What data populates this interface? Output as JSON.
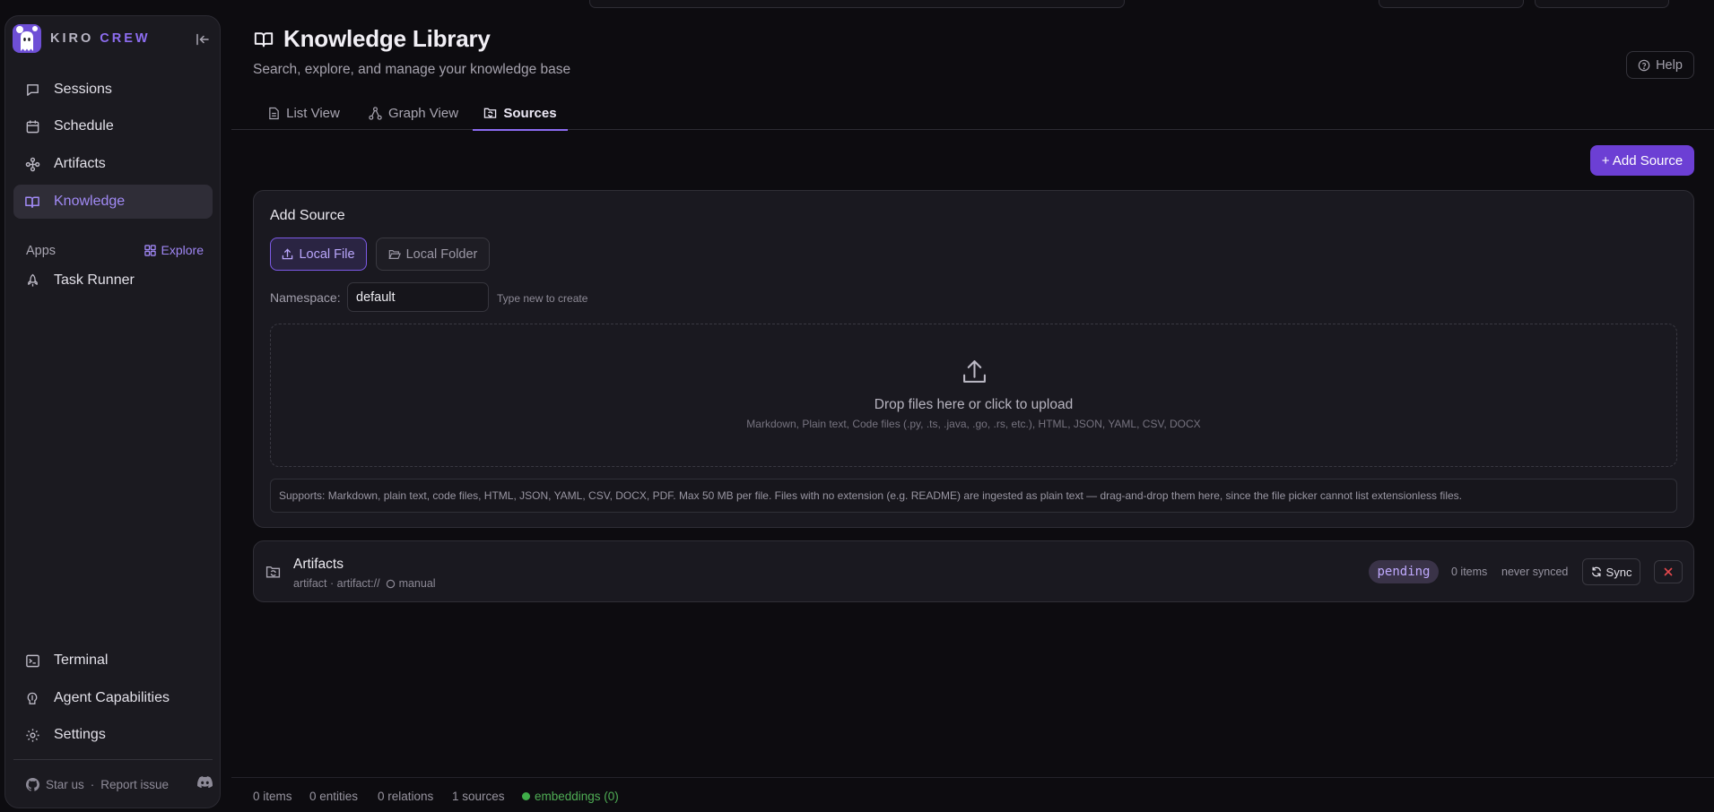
{
  "brand": {
    "word1": "KIRO",
    "word2": "CREW"
  },
  "colors": {
    "accent": "#6c3fd4",
    "accent_text": "#a18af5",
    "background": "#0d0c10",
    "panel": "#1a1920",
    "success": "#3fae49",
    "danger": "#e5484d"
  },
  "sidebar": {
    "nav": [
      {
        "label": "Sessions",
        "icon": "chat-bubble-icon"
      },
      {
        "label": "Schedule",
        "icon": "calendar-icon"
      },
      {
        "label": "Artifacts",
        "icon": "artifacts-icon"
      },
      {
        "label": "Knowledge",
        "icon": "book-icon",
        "active": true
      }
    ],
    "apps_label": "Apps",
    "explore_label": "Explore",
    "apps": [
      {
        "label": "Task Runner",
        "icon": "rocket-icon"
      }
    ],
    "bottom_nav": [
      {
        "label": "Terminal",
        "icon": "terminal-icon"
      },
      {
        "label": "Agent Capabilities",
        "icon": "brain-icon"
      },
      {
        "label": "Settings",
        "icon": "gear-icon"
      }
    ],
    "footer": {
      "star": "Star us",
      "separator": "·",
      "report": "Report issue"
    }
  },
  "header": {
    "title": "Knowledge Library",
    "subtitle": "Search, explore, and manage your knowledge base",
    "help_label": "Help"
  },
  "tabs": [
    {
      "label": "List View",
      "icon": "document-icon"
    },
    {
      "label": "Graph View",
      "icon": "graph-icon"
    },
    {
      "label": "Sources",
      "icon": "folder-sync-icon",
      "active": true
    }
  ],
  "add_source_button": "+ Add Source",
  "add_source_panel": {
    "title": "Add Source",
    "local_file_label": "Local File",
    "local_folder_label": "Local Folder",
    "namespace_label": "Namespace:",
    "namespace_value": "default",
    "namespace_hint": "Type new to create",
    "dropzone_title": "Drop files here or click to upload",
    "dropzone_formats": "Markdown, Plain text, Code files (.py, .ts, .java, .go, .rs, etc.), HTML, JSON, YAML, CSV, DOCX",
    "supports_text": "Supports: Markdown, plain text, code files, HTML, JSON, YAML, CSV, DOCX, PDF. Max 50 MB per file. Files with no extension (e.g. README) are ingested as plain text — drag-and-drop them here, since the file picker cannot list extensionless files."
  },
  "sources": [
    {
      "name": "Artifacts",
      "meta": "artifact · artifact://",
      "mode": "manual",
      "status": "pending",
      "items": "0 items",
      "synced": "never synced",
      "sync_label": "Sync"
    }
  ],
  "status_bar": {
    "items": "0 items",
    "entities": "0 entities",
    "relations": "0 relations",
    "sources": "1 sources",
    "embeddings": "embeddings (0)"
  }
}
